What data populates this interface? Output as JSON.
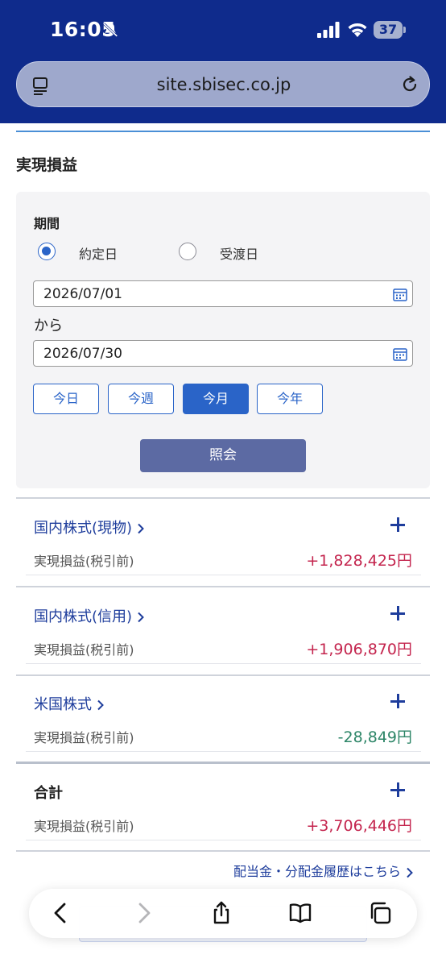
{
  "status_bar": {
    "time": "16:05",
    "battery": "37"
  },
  "browser": {
    "url": "site.sbisec.co.jp"
  },
  "page": {
    "title": "実現損益",
    "period": {
      "label": "期間",
      "options": [
        "約定日",
        "受渡日"
      ],
      "selected": "約定日",
      "from_date": "2026/07/01",
      "to_label": "から",
      "to_date": "2026/07/30"
    },
    "quick_buttons": [
      "今日",
      "今週",
      "今月",
      "今年"
    ],
    "quick_active": "今月",
    "query_button": "照会"
  },
  "sections": [
    {
      "title": "国内株式(現物)",
      "row_label": "実現損益(税引前)",
      "value": "+1,828,425円",
      "sign": "positive"
    },
    {
      "title": "国内株式(信用)",
      "row_label": "実現損益(税引前)",
      "value": "+1,906,870円",
      "sign": "positive"
    },
    {
      "title": "米国株式",
      "row_label": "実現損益(税引前)",
      "value": "-28,849円",
      "sign": "negative"
    },
    {
      "title": "合計",
      "row_label": "実現損益(税引前)",
      "value": "+3,706,446円",
      "sign": "positive"
    }
  ],
  "dividend_link": "配当金・分配金履歴はこちら",
  "toolbar": {
    "icons": [
      "back-icon",
      "forward-icon",
      "share-icon",
      "bookmarks-icon",
      "tabs-icon"
    ]
  },
  "colors": {
    "brand_blue": "#0f2b8c",
    "accent_blue": "#2a64c8",
    "positive": "#c4254e",
    "negative": "#2e8668"
  }
}
